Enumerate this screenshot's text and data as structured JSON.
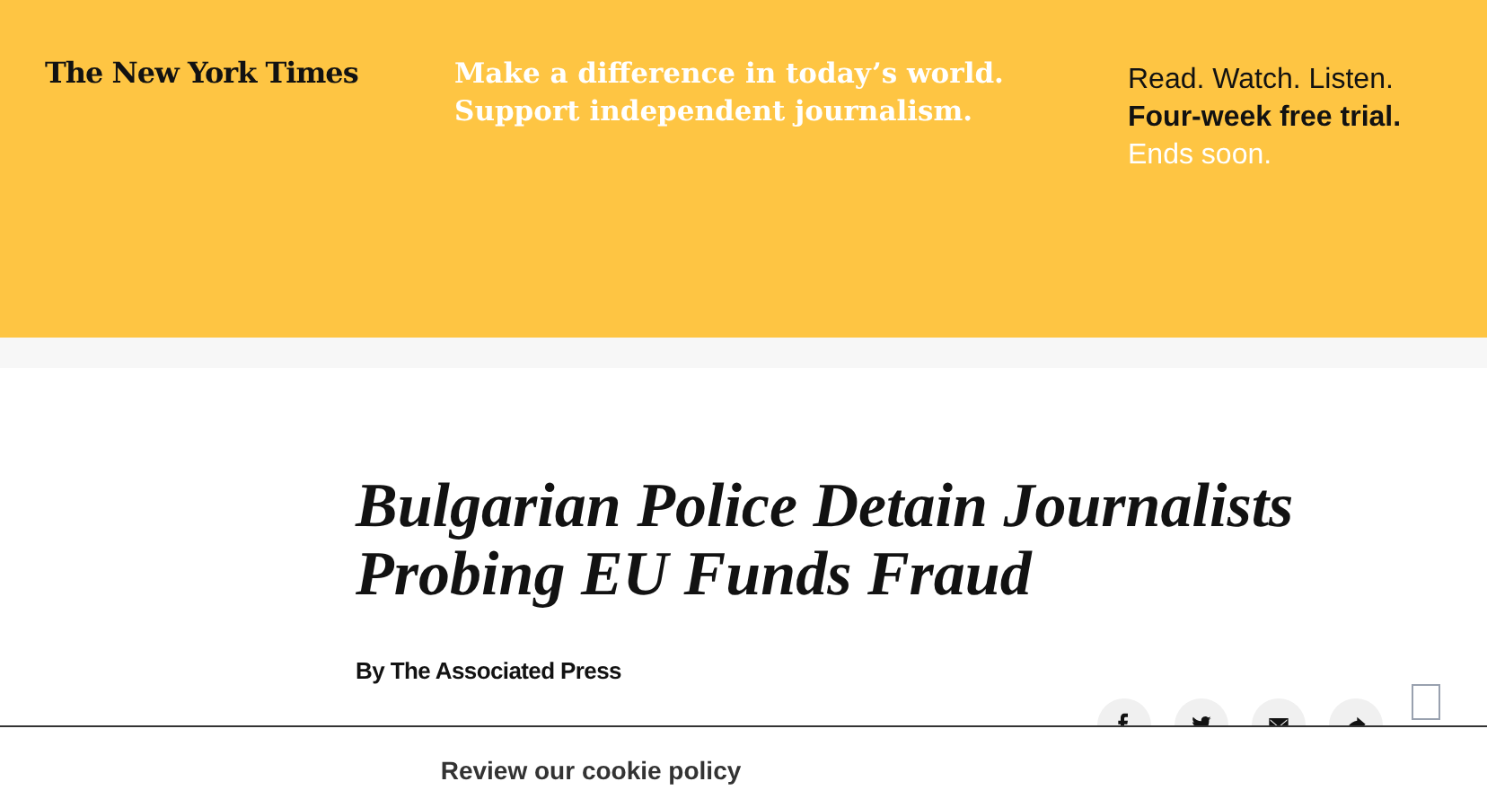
{
  "banner": {
    "logo": "The New York Times",
    "headline_lines": [
      "Make a difference in today’s world.",
      "Support independent journalism."
    ],
    "offer_lines": [
      {
        "text": "Read. Watch. Listen.",
        "kind": "plain"
      },
      {
        "text": "Four-week free trial.",
        "kind": "bold"
      },
      {
        "text": "Ends soon.",
        "kind": "muted"
      }
    ]
  },
  "article": {
    "title_lines": [
      "Bulgarian Police Detain Journalists",
      "Probing EU Funds Fraud"
    ],
    "byline": "By The Associated Press"
  },
  "share_tools": [
    {
      "kind": "facebook"
    },
    {
      "kind": "twitter"
    },
    {
      "kind": "email"
    },
    {
      "kind": "share"
    },
    {
      "kind": "bookmark"
    }
  ],
  "cookie_bar": {
    "link": "Review our cookie policy"
  }
}
